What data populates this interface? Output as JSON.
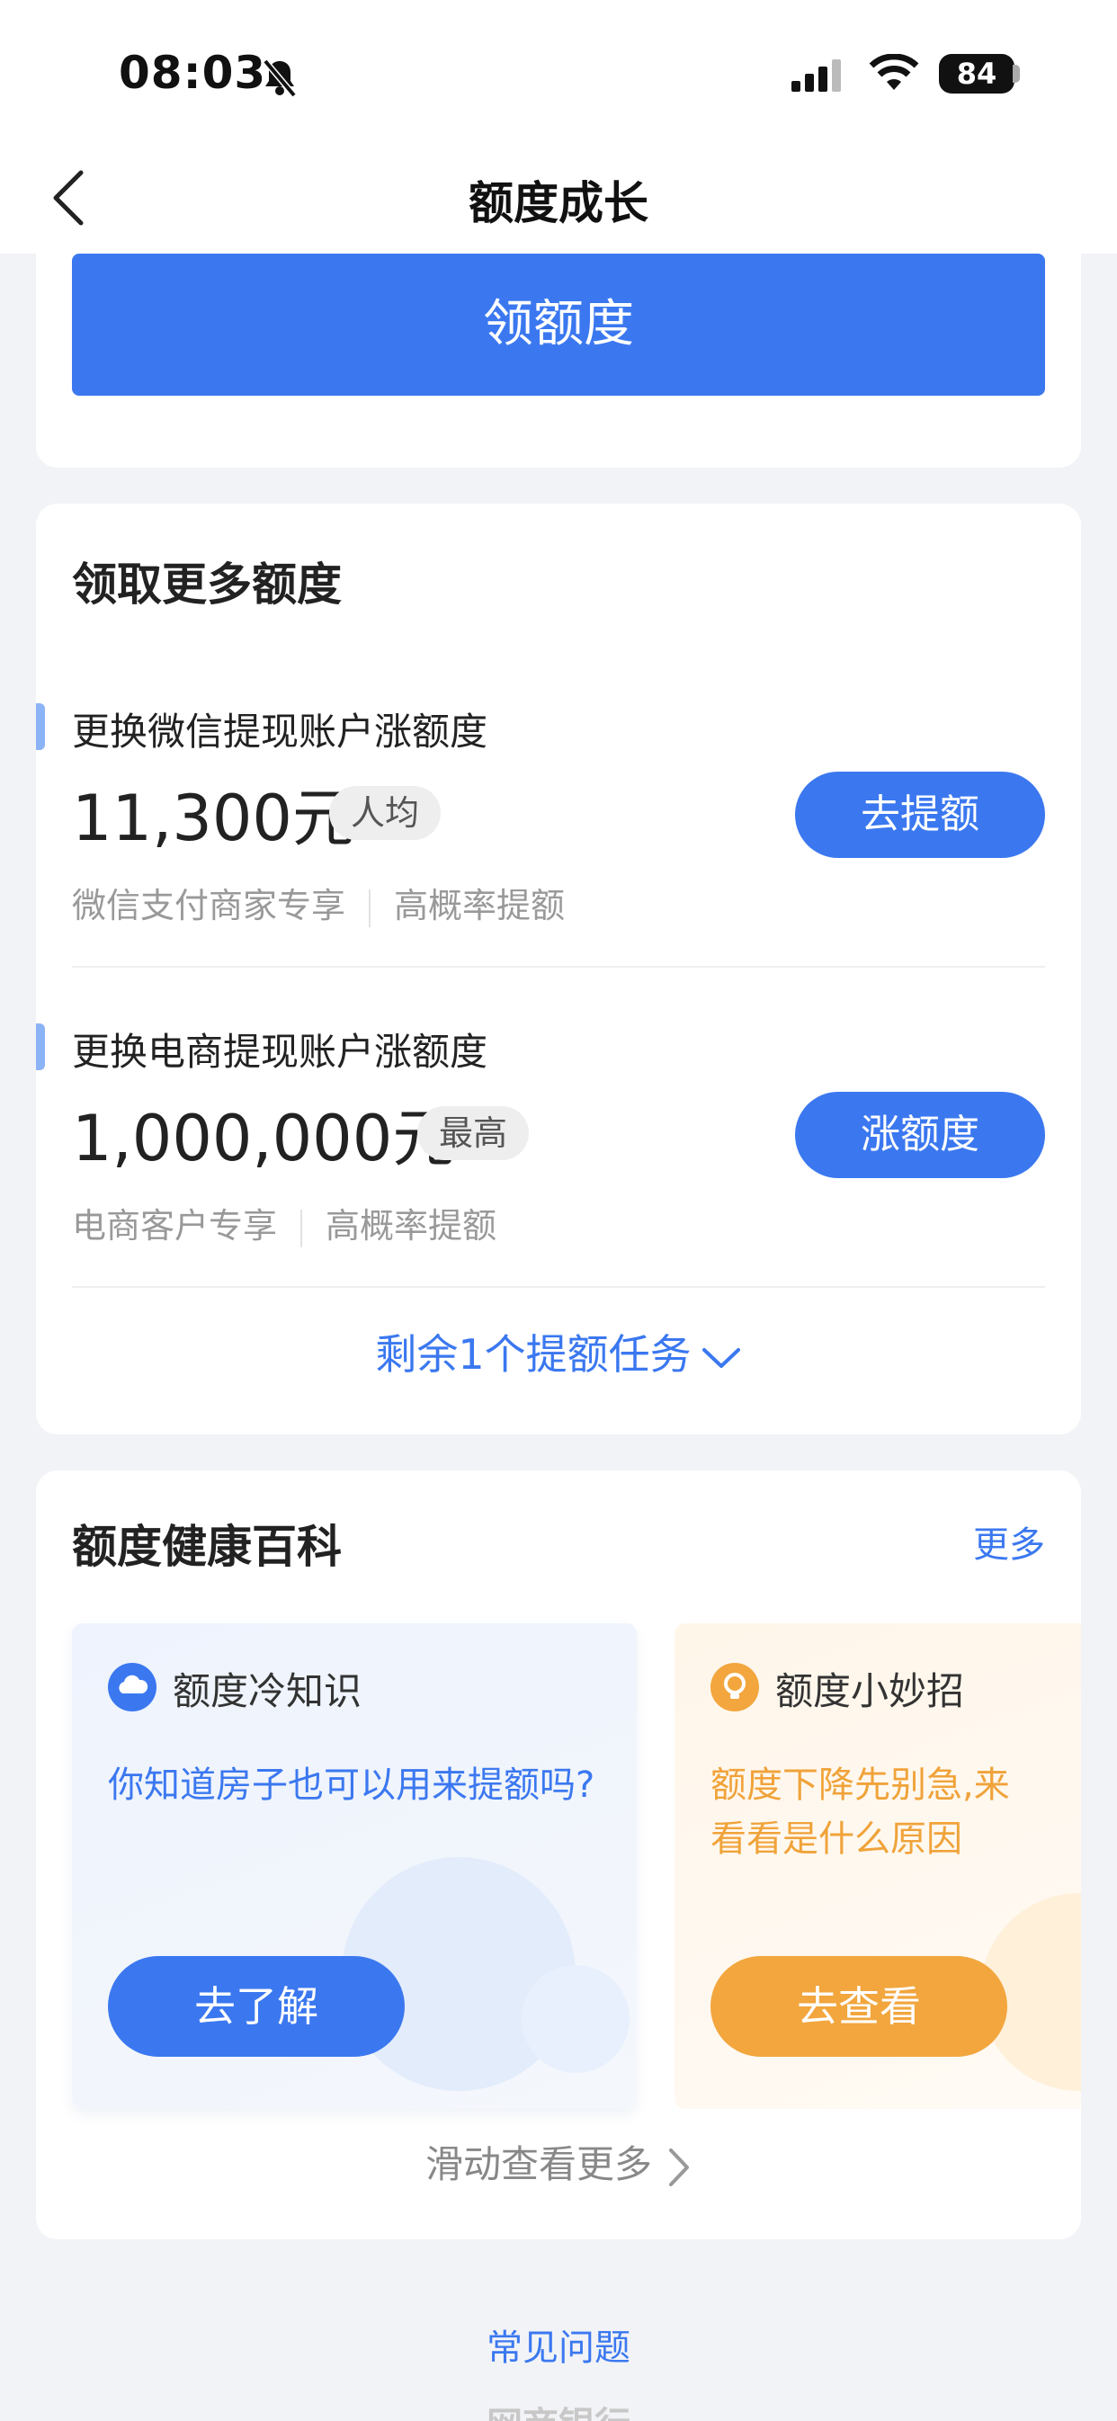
{
  "status_bar": {
    "time": "08:03",
    "battery": "84"
  },
  "nav": {
    "title": "额度成长"
  },
  "top_card": {
    "claim_button": "领额度"
  },
  "more_quota": {
    "title": "领取更多额度",
    "tasks": [
      {
        "title": "更换微信提现账户涨额度",
        "amount": "11,300元",
        "badge": "人均",
        "tags": [
          "微信支付商家专享",
          "高概率提额"
        ],
        "button": "去提额"
      },
      {
        "title": "更换电商提现账户涨额度",
        "amount": "1,000,000元",
        "badge": "最高",
        "tags": [
          "电商客户专享",
          "高概率提额"
        ],
        "button": "涨额度"
      }
    ],
    "remaining_tasks": "剩余1个提额任务"
  },
  "encyclopedia": {
    "title": "额度健康百科",
    "more": "更多",
    "cards": [
      {
        "head": "额度冷知识",
        "text": "你知道房子也可以用来提额吗?",
        "button": "去了解",
        "accent": "#3b78f0"
      },
      {
        "head": "额度小妙招",
        "text": "额度下降先别急,来看看是什么原因",
        "button": "去查看",
        "accent": "#f2a63d"
      }
    ],
    "swipe_hint": "滑动查看更多"
  },
  "footer": {
    "faq": "常见问题",
    "bank": "网商银行"
  },
  "colors": {
    "primary": "#3b78f0",
    "orange": "#f2a63d",
    "background": "#f2f3f7"
  }
}
